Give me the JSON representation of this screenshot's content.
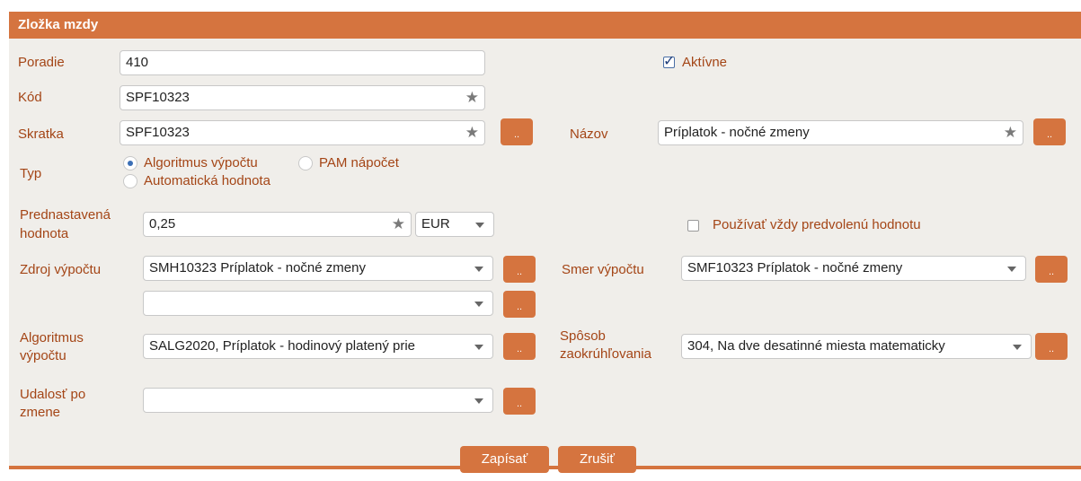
{
  "form": {
    "title": "Zložka mzdy",
    "poradie": {
      "label": "Poradie",
      "value": "410"
    },
    "aktivne": {
      "label": "Aktívne",
      "checked": true
    },
    "kod": {
      "label": "Kód",
      "value": "SPF10323"
    },
    "skratka": {
      "label": "Skratka",
      "value": "SPF10323"
    },
    "nazov": {
      "label": "Názov",
      "value": "Príplatok - nočné zmeny"
    },
    "typ": {
      "label": "Typ",
      "options": [
        "Algoritmus výpočtu",
        "PAM nápočet",
        "Automatická hodnota"
      ],
      "selected": "Algoritmus výpočtu"
    },
    "prednastavena": {
      "label_line1": "Prednastavená",
      "label_line2": "hodnota",
      "value": "0,25",
      "currency": "EUR"
    },
    "pouzivat": {
      "label": "Používať vždy predvolenú hodnotu",
      "checked": false
    },
    "zdroj": {
      "label": "Zdroj výpočtu",
      "value": "SMH10323 Príplatok - nočné zmeny",
      "value2": ""
    },
    "smer": {
      "label": "Smer výpočtu",
      "value": "SMF10323 Príplatok - nočné zmeny"
    },
    "algoritmus": {
      "label_line1": "Algoritmus",
      "label_line2": "výpočtu",
      "value": "SALG2020, Príplatok - hodinový platený prie"
    },
    "sposob": {
      "label_line1": "Spôsob",
      "label_line2": "zaokrúhľovania",
      "value": "304, Na dve desatinné miesta matematicky"
    },
    "udalost": {
      "label_line1": "Udalosť po",
      "label_line2": "zmene",
      "value": ""
    },
    "dots_label": "..",
    "buttons": {
      "save": "Zapísať",
      "cancel": "Zrušiť"
    }
  },
  "icons": {
    "star": "star-icon",
    "caret": "chevron-down-icon",
    "check": "checkmark-icon"
  },
  "colors": {
    "accent": "#d5743f",
    "label": "#a44516",
    "panel": "#f0eeea"
  }
}
